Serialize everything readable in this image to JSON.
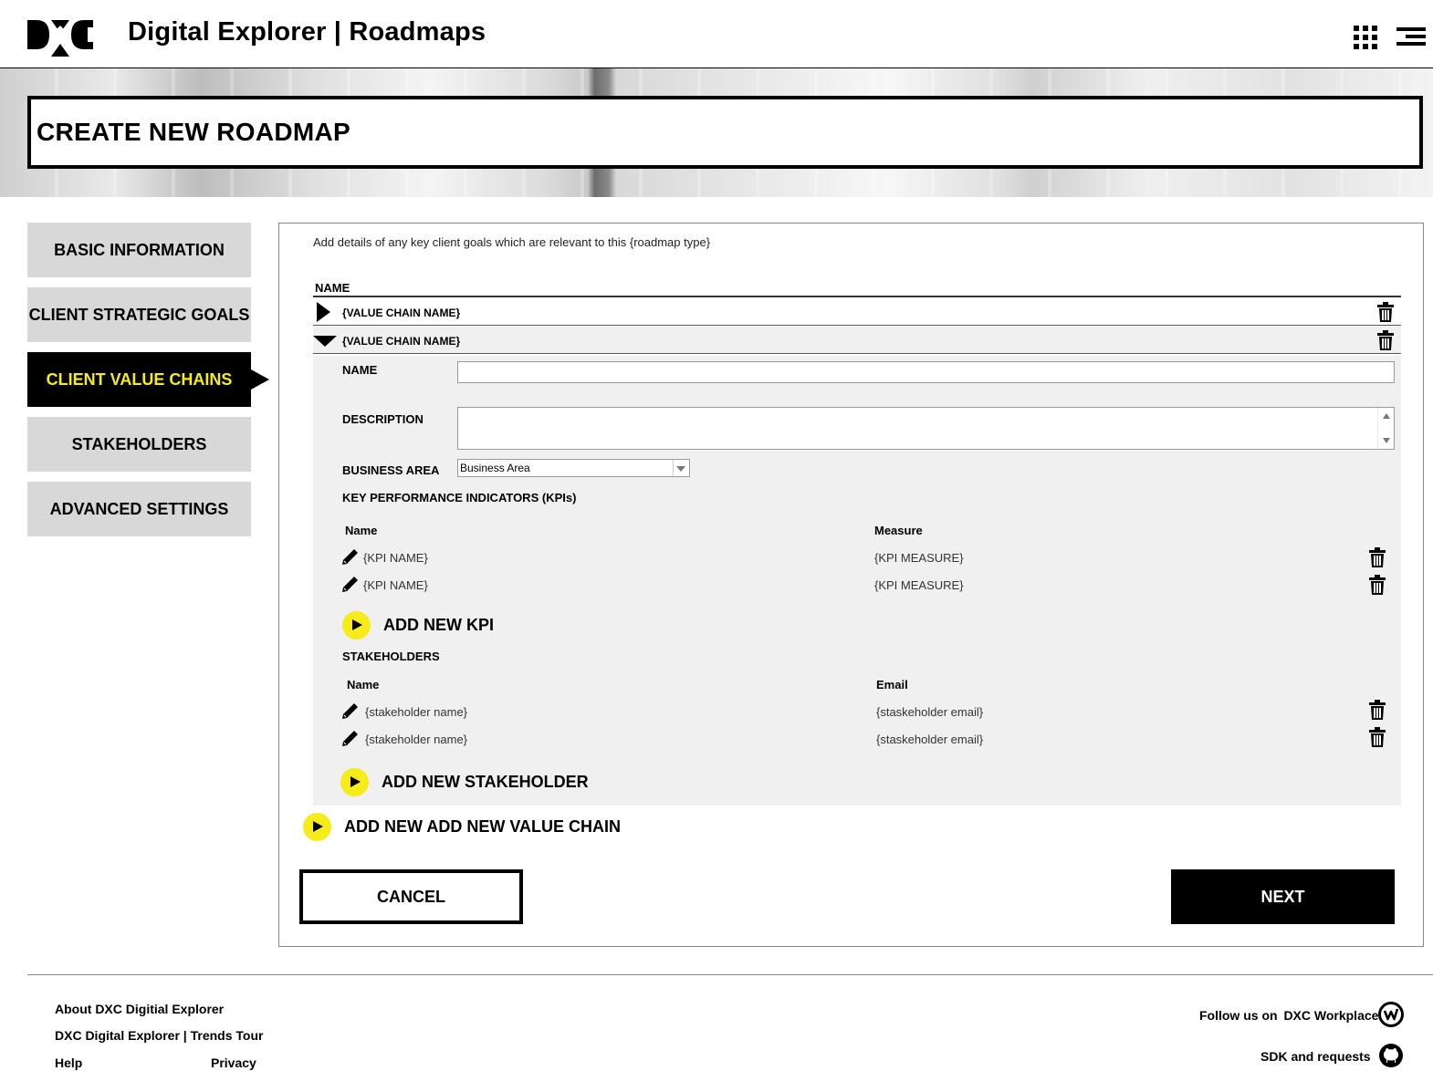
{
  "header": {
    "app_title": "Digital Explorer | Roadmaps",
    "logo_icon": "dxc-logo",
    "apps_icon": "apps-grid-icon",
    "menu_icon": "hamburger-menu-icon"
  },
  "hero": {
    "page_title": "CREATE NEW ROADMAP"
  },
  "sidebar": {
    "items": [
      {
        "label": "BASIC INFORMATION",
        "active": false
      },
      {
        "label": "CLIENT STRATEGIC GOALS",
        "active": false
      },
      {
        "label": "CLIENT VALUE CHAINS",
        "active": true
      },
      {
        "label": "STAKEHOLDERS",
        "active": false
      },
      {
        "label": "ADVANCED SETTINGS",
        "active": false
      }
    ]
  },
  "main": {
    "intro": "Add details of any key client goals which are relevant to this {roadmap type}",
    "name_column_header": "NAME",
    "value_chains": [
      {
        "label": "{VALUE CHAIN NAME}",
        "expanded": false
      },
      {
        "label": "{VALUE CHAIN NAME}",
        "expanded": true
      }
    ],
    "form": {
      "name_label": "NAME",
      "name_value": "",
      "description_label": "DESCRIPTION",
      "description_value": "",
      "business_area_label": "BUSINESS AREA",
      "business_area_selected": "Business Area",
      "kpi_section_label": "KEY PERFORMANCE INDICATORS (KPIs)",
      "kpi_headers": {
        "name": "Name",
        "measure": "Measure"
      },
      "kpis": [
        {
          "name": "{KPI NAME}",
          "measure": "{KPI MEASURE}"
        },
        {
          "name": "{KPI NAME}",
          "measure": "{KPI MEASURE}"
        }
      ],
      "add_kpi_label": "ADD NEW KPI",
      "stakeholders_label": "STAKEHOLDERS",
      "stakeholder_headers": {
        "name": "Name",
        "email": "Email"
      },
      "stakeholders": [
        {
          "name": "{stakeholder name}",
          "email": "{staskeholder email}"
        },
        {
          "name": "{stakeholder name}",
          "email": "{staskeholder email}"
        }
      ],
      "add_stakeholder_label": "ADD NEW STAKEHOLDER"
    },
    "add_value_chain_label": "ADD NEW ADD NEW VALUE CHAIN",
    "cancel_label": "CANCEL",
    "next_label": "NEXT"
  },
  "footer": {
    "about": "About DXC Digitial Explorer",
    "trends_tour": "DXC Digital Explorer | Trends Tour",
    "help": "Help",
    "privacy": "Privacy",
    "follow_prefix": "Follow us on",
    "follow_target": "DXC Workplace",
    "sdk": "SDK and requests",
    "workplace_icon": "workplace-icon",
    "github_icon": "github-icon"
  },
  "colors": {
    "accent_yellow": "#f5ec1a",
    "active_nav_bg": "#000000",
    "nav_bg": "#d8d8d8",
    "expanded_bg": "#f0f0f0"
  }
}
